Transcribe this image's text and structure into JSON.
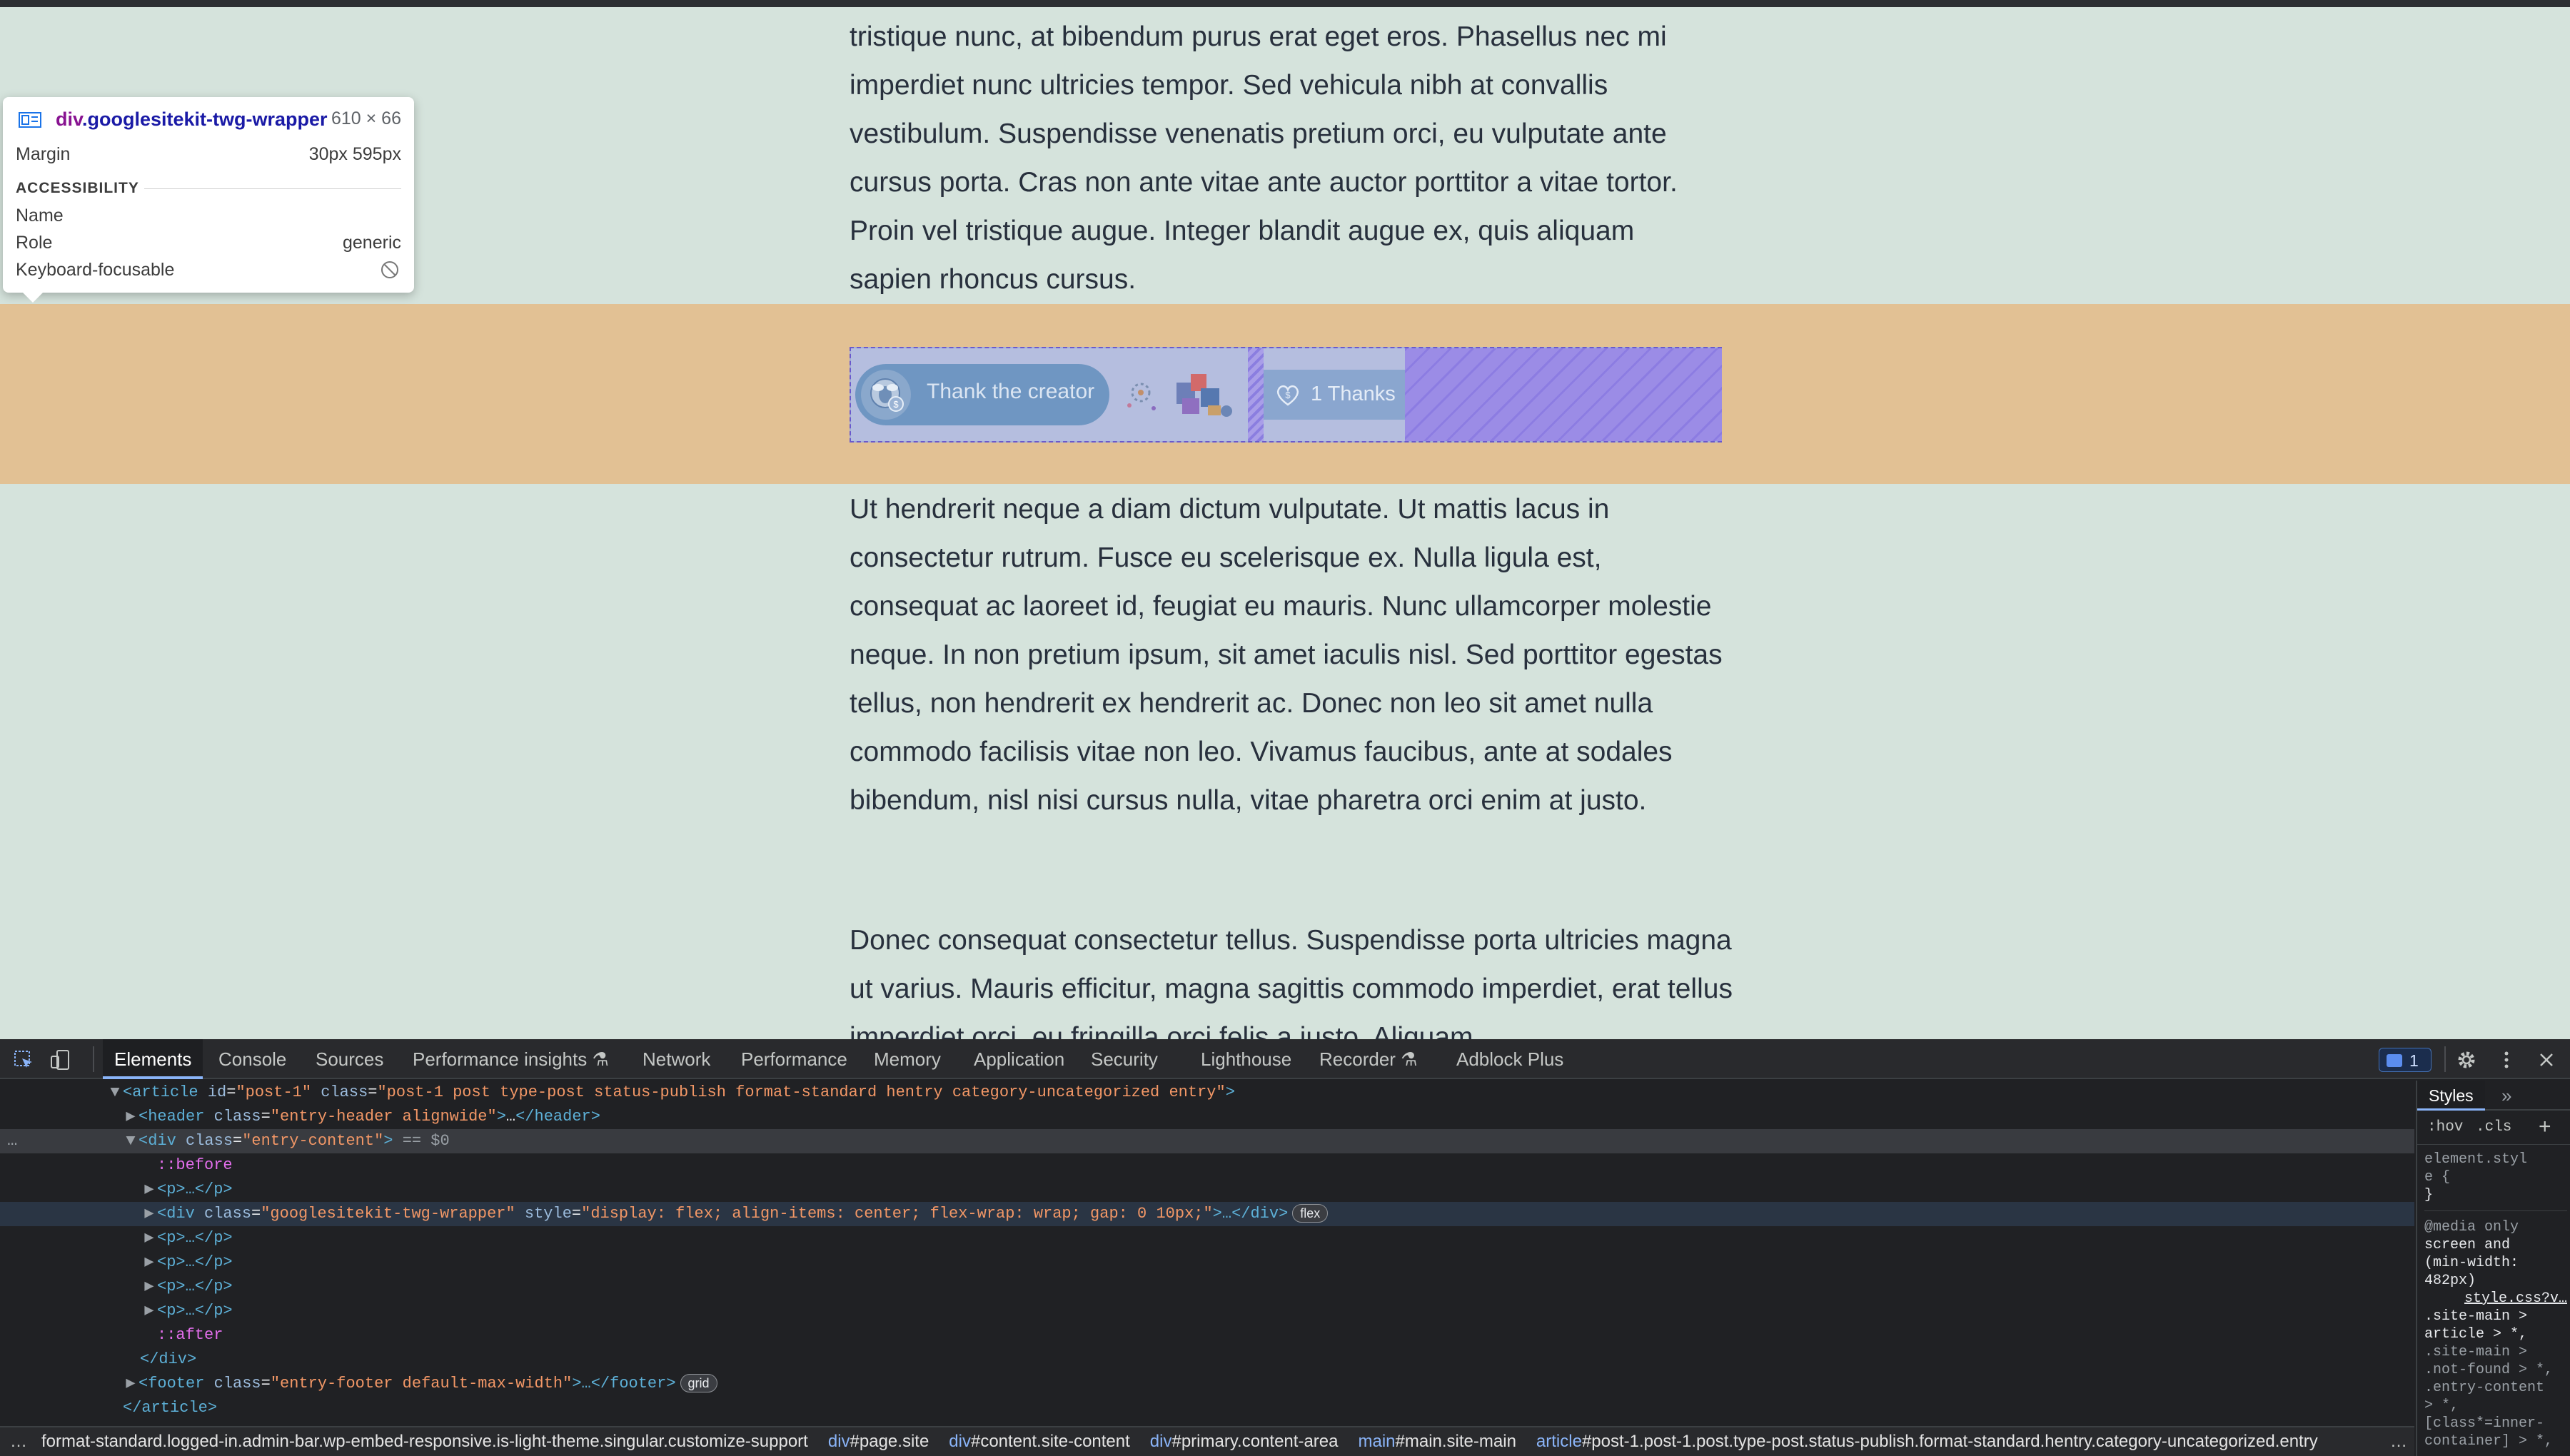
{
  "page": {
    "para1": "tristique nunc, at bibendum purus erat eget eros. Phasellus nec mi imperdiet nunc ultricies tempor. Sed vehicula nibh at convallis vestibulum. Suspendisse venenatis pretium orci, eu vulputate ante cursus porta. Cras non ante vitae ante auctor porttitor a vitae tortor. Proin vel tristique augue. Integer blandit augue ex, quis aliquam sapien rhoncus cursus.",
    "para2": "Ut hendrerit neque a diam dictum vulputate. Ut mattis lacus in consectetur rutrum. Fusce eu scelerisque ex. Nulla ligula est, consequat ac laoreet id, feugiat eu mauris. Nunc ullamcorper molestie neque. In non pretium ipsum, sit amet iaculis nisl. Sed porttitor egestas tellus, non hendrerit ex hendrerit ac. Donec non leo sit amet nulla commodo facilisis vitae non leo. Vivamus faucibus, ante at sodales bibendum, nisl nisi cursus nulla, vitae pharetra orci enim at justo.",
    "para3": "Donec consequat consectetur tellus. Suspendisse porta ultricies magna ut varius. Mauris efficitur, magna sagittis commodo imperdiet, erat tellus imperdiet orci, eu fringilla orci felis a justo. Aliquam",
    "twg": {
      "thank_label": "Thank the creator",
      "counter_label": "1 Thanks"
    }
  },
  "tooltip": {
    "selector_tag": "div",
    "selector_class": ".googlesitekit-twg-wrapper",
    "size": "610 × 66",
    "margin_label": "Margin",
    "margin_value": "30px 595px",
    "accessibility_heading": "ACCESSIBILITY",
    "name_label": "Name",
    "role_label": "Role",
    "role_value": "generic",
    "keyboard_label": "Keyboard-focusable"
  },
  "devtools": {
    "tabs": [
      "Elements",
      "Console",
      "Sources",
      "Performance insights",
      "Network",
      "Performance",
      "Memory",
      "Application",
      "Security",
      "Lighthouse",
      "Recorder",
      "Adblock Plus"
    ],
    "issues_count": "1",
    "dom": {
      "article_open_tag": "article",
      "article_id_attr": "id",
      "article_id_val": "\"post-1\"",
      "article_class_attr": "class",
      "article_class_val": "\"post-1 post type-post status-publish format-standard hentry category-uncategorized entry\"",
      "header_tag": "header",
      "header_class_val": "\"entry-header alignwide\"",
      "header_close": "</header>",
      "entry_div_tag": "div",
      "entry_div_class_val": "\"entry-content\"",
      "selected_marker": "== $0",
      "before": "::before",
      "after": "::after",
      "p_collapsed": "<p>…</p>",
      "twg_div_class_val": "\"googlesitekit-twg-wrapper\"",
      "twg_div_style_attr": "style",
      "twg_div_style_val": "\"display: flex; align-items: center; flex-wrap: wrap; gap: 0 10px;\"",
      "twg_div_close": ">…</div>",
      "flex_badge": "flex",
      "div_close": "</div>",
      "footer_tag": "footer",
      "footer_class_val": "\"entry-footer default-max-width\"",
      "footer_close": ">…</footer>",
      "grid_badge": "grid",
      "article_close": "</article>"
    },
    "breadcrumbs": [
      {
        "tag": "",
        "rest": "format-standard.logged-in.admin-bar.wp-embed-responsive.is-light-theme.singular.customize-support"
      },
      {
        "tag": "div",
        "rest": "#page.site"
      },
      {
        "tag": "div",
        "rest": "#content.site-content"
      },
      {
        "tag": "div",
        "rest": "#primary.content-area"
      },
      {
        "tag": "main",
        "rest": "#main.site-main"
      },
      {
        "tag": "article",
        "rest": "#post-1.post-1.post.type-post.status-publish.format-standard.hentry.category-uncategorized.entry"
      }
    ],
    "styles": {
      "tab_label": "Styles",
      "hov": ":hov",
      "cls": ".cls",
      "element_style_1": "element.styl",
      "element_style_2": "e {",
      "element_style_3": "}",
      "media_1": "@media only",
      "media_2": "screen and",
      "media_3": "(min-width:",
      "media_4": "482px)",
      "source_link": "style.css?v…",
      "rule_1": ".site-main >",
      "rule_2": "article > *,",
      "rule_3": ".site-main >",
      "rule_4": ".not-found > *,",
      "rule_5": ".entry-content",
      "rule_6": "> *,",
      "rule_7": "[class*=inner-",
      "rule_8": "container] > *,"
    }
  }
}
